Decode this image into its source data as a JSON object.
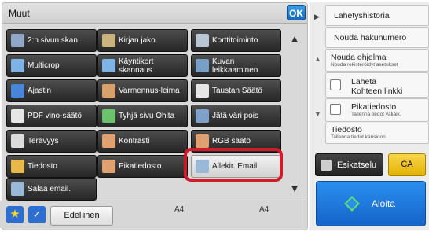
{
  "header": {
    "title": "Muut",
    "ok_label": "OK"
  },
  "functions": [
    {
      "label": "2:n sivun skan",
      "icon": "two-page-scan-icon",
      "icon_color": "#8fa8c8"
    },
    {
      "label": "Kirjan jako",
      "icon": "book-divide-icon",
      "icon_color": "#c9b47b"
    },
    {
      "label": "Korttitoiminto",
      "icon": "card-shot-icon",
      "icon_color": "#b9c6d4"
    },
    {
      "label": "Multicrop",
      "icon": "multicrop-icon",
      "icon_color": "#7fb3e6"
    },
    {
      "label": "Käyntikort skannaus",
      "icon": "business-card-scan-icon",
      "icon_color": "#7fb3e6"
    },
    {
      "label": "Kuvan leikkaaminen",
      "icon": "image-crop-icon",
      "icon_color": "#7a9fc7"
    },
    {
      "label": "Ajastin",
      "icon": "timer-icon",
      "icon_color": "#4a86d8"
    },
    {
      "label": "Varmennus-leima",
      "icon": "verification-stamp-icon",
      "icon_color": "#d8a06a"
    },
    {
      "label": "Taustan Säätö",
      "icon": "background-adjust-icon",
      "icon_color": "#e6e6e6"
    },
    {
      "label": "PDF vino-säätö",
      "icon": "pdf-skew-adjust-icon",
      "icon_color": "#e6e6e6"
    },
    {
      "label": "Tyhjä sivu Ohita",
      "icon": "blank-page-skip-icon",
      "icon_color": "#6cc26c"
    },
    {
      "label": "Jätä väri pois",
      "icon": "color-drop-out-icon",
      "icon_color": "#7fa0c8"
    },
    {
      "label": "Terävyys",
      "icon": "sharpness-icon",
      "icon_color": "#dcdcdc"
    },
    {
      "label": "Kontrasti",
      "icon": "contrast-icon",
      "icon_color": "#e0a070"
    },
    {
      "label": "RGB säätö",
      "icon": "rgb-adjust-icon",
      "icon_color": "#e0a070"
    },
    {
      "label": "Tiedosto",
      "icon": "file-folder-icon",
      "icon_color": "#e8b84a"
    },
    {
      "label": "Pikatiedosto",
      "icon": "quick-file-icon",
      "icon_color": "#e0a070"
    },
    {
      "label": "Allekir. Email",
      "icon": "signed-email-icon",
      "icon_color": "#9ab8d8"
    },
    {
      "label": "Salaa email.",
      "icon": "encrypt-email-icon",
      "icon_color": "#9ab8d8"
    }
  ],
  "bottom": {
    "prev_label": "Edellinen",
    "paper_left": "A4",
    "paper_right": "A4"
  },
  "sidebar": {
    "history": "Lähetyshistoria",
    "recall_number": "Nouda hakunumero",
    "recall_program": "Nouda ohjelma",
    "recall_program_sub": "Nouda rekisteröidyt asetukset",
    "send_line1": "Lähetä",
    "send_line2": "Kohteen linkki",
    "quick_file": "Pikatiedosto",
    "quick_file_sub": "Tallenna tiedot väliaik.",
    "file": "Tiedosto",
    "file_sub": "Tallenna tiedot kansioon"
  },
  "actions": {
    "preview": "Esikatselu",
    "ca": "CA",
    "start": "Aloita"
  }
}
